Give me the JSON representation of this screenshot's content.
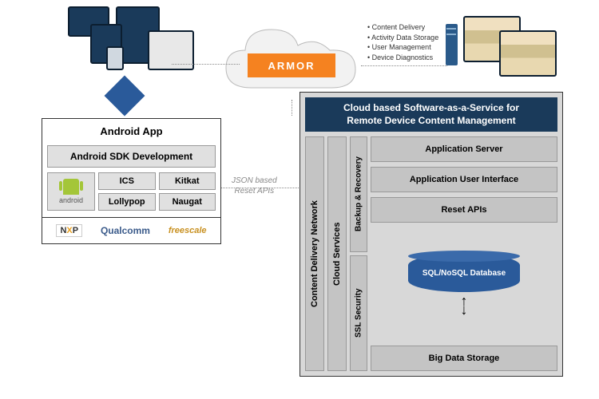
{
  "cloud": {
    "brand": "ARMOR"
  },
  "cloud_labels": [
    "Content Delivery",
    "Activity Data Storage",
    "User Management",
    "Device Diagnostics"
  ],
  "left": {
    "title": "Android App",
    "sdk": "Android SDK Development",
    "android_label": "android",
    "versions": [
      "ICS",
      "Kitkat",
      "Lollypop",
      "Naugat"
    ],
    "vendors": {
      "nxp_a": "N",
      "nxp_b": "X",
      "nxp_c": "P",
      "qualcomm": "Qualcomm",
      "freescale": "freescale"
    }
  },
  "connection": {
    "line1": "JSON based",
    "line2": "Reset APIs"
  },
  "right": {
    "title_l1": "Cloud based Software-as-a-Service for",
    "title_l2": "Remote Device Content Management",
    "cdn": "Content Delivery Network",
    "cloud_services": "Cloud Services",
    "backup": "Backup & Recovery",
    "ssl": "SSL Security",
    "app_server": "Application Server",
    "app_ui": "Application User Interface",
    "reset_apis": "Reset APIs",
    "database": "SQL/NoSQL Database",
    "big_data": "Big Data Storage"
  }
}
